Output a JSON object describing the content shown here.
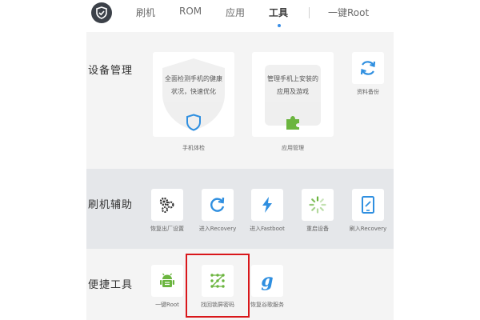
{
  "nav": {
    "items": [
      "刷机",
      "ROM",
      "应用",
      "工具",
      "一键Root"
    ],
    "active": "工具"
  },
  "device_management": {
    "title": "设备管理",
    "cards": [
      {
        "line1": "全面检测手机的健康",
        "line2": "状况，快速优化",
        "label": "手机体检"
      },
      {
        "line1": "管理手机上安装的",
        "line2": "应用及游戏",
        "label": "应用管理"
      }
    ],
    "backup_label": "资料备份"
  },
  "flash_helper": {
    "title": "刷机辅助",
    "tools": [
      "恢复出厂设置",
      "进入Recovery",
      "进入Fastboot",
      "重启设备",
      "刷入Recovery"
    ]
  },
  "quick_tools": {
    "title": "便捷工具",
    "tools": [
      "一键Root",
      "找回锁屏密码",
      "恢复谷歌服务"
    ]
  },
  "colors": {
    "accent": "#3a8ee6",
    "icon_blue": "#2f8fe0",
    "icon_green": "#6bb53f",
    "highlight": "#d9171b"
  },
  "icons": [
    "shield-logo-icon",
    "shield-icon",
    "puzzle-icon",
    "sync-icon",
    "gears-icon",
    "refresh-icon",
    "lightning-icon",
    "loading-icon",
    "tablet-icon",
    "android-icon",
    "pattern-lock-icon",
    "google-g-icon"
  ]
}
